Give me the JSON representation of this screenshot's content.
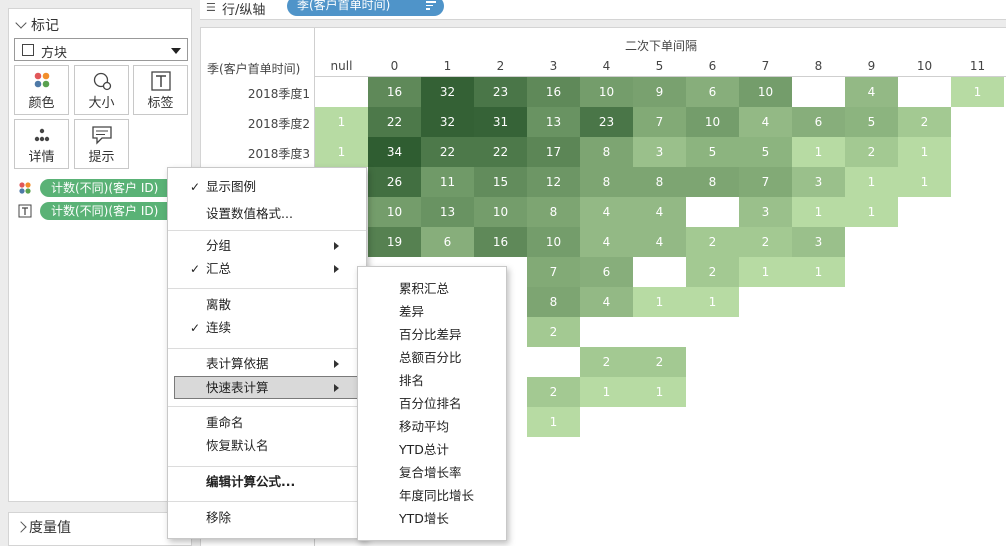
{
  "marks": {
    "title": "标记",
    "mark_type": "方块",
    "buttons": [
      {
        "label": "颜色",
        "icon": "color-dots-icon"
      },
      {
        "label": "大小",
        "icon": "size-icon"
      },
      {
        "label": "标签",
        "icon": "label-T-icon"
      },
      {
        "label": "详情",
        "icon": "detail-dots-icon"
      },
      {
        "label": "提示",
        "icon": "tooltip-icon"
      }
    ],
    "pills": [
      {
        "label": "计数(不同)(客户 ID)",
        "icon": "color-dots-icon"
      },
      {
        "label": "计数(不同)(客户 ID)",
        "icon": "label-T-icon"
      }
    ]
  },
  "measure_values": {
    "label": "度量值"
  },
  "rows_shelf": {
    "label": "行/纵轴",
    "pill": "季(客户首单时间)",
    "accent": "#4f94c9"
  },
  "view": {
    "column_header_title": "二次下单间隔",
    "row_header_title": "季(客户首单时间)",
    "columns": [
      "null",
      "0",
      "1",
      "2",
      "3",
      "4",
      "5",
      "6",
      "7",
      "8",
      "9",
      "10",
      "11"
    ],
    "rows": [
      {
        "label": "2018季度1",
        "values": [
          null,
          16,
          32,
          23,
          16,
          10,
          9,
          6,
          10,
          null,
          4,
          null,
          1
        ]
      },
      {
        "label": "2018季度2",
        "values": [
          1,
          22,
          32,
          31,
          13,
          23,
          7,
          10,
          4,
          6,
          5,
          2,
          null
        ]
      },
      {
        "label": "2018季度3",
        "values": [
          1,
          34,
          22,
          22,
          17,
          8,
          3,
          5,
          5,
          1,
          2,
          1,
          null
        ]
      },
      {
        "label": "",
        "values": [
          null,
          26,
          11,
          15,
          12,
          8,
          8,
          8,
          7,
          3,
          1,
          1,
          null
        ]
      },
      {
        "label": "",
        "values": [
          null,
          10,
          13,
          10,
          8,
          4,
          4,
          null,
          3,
          1,
          1,
          null,
          null
        ]
      },
      {
        "label": "",
        "values": [
          null,
          19,
          6,
          16,
          10,
          4,
          4,
          2,
          2,
          3,
          null,
          null,
          null
        ]
      },
      {
        "label": "",
        "values": [
          null,
          null,
          null,
          null,
          7,
          6,
          null,
          2,
          1,
          1,
          null,
          null,
          null
        ]
      },
      {
        "label": "",
        "values": [
          null,
          null,
          null,
          null,
          8,
          4,
          1,
          1,
          null,
          null,
          null,
          null,
          null
        ]
      },
      {
        "label": "",
        "values": [
          null,
          null,
          null,
          null,
          2,
          null,
          null,
          null,
          null,
          null,
          null,
          null,
          null
        ]
      },
      {
        "label": "",
        "values": [
          null,
          null,
          null,
          null,
          null,
          2,
          2,
          null,
          null,
          null,
          null,
          null,
          null
        ]
      },
      {
        "label": "",
        "values": [
          null,
          null,
          null,
          null,
          2,
          1,
          1,
          null,
          null,
          null,
          null,
          null,
          null
        ]
      },
      {
        "label": "",
        "values": [
          null,
          null,
          null,
          null,
          1,
          null,
          null,
          null,
          null,
          null,
          null,
          null,
          null
        ]
      }
    ],
    "color_low": "#b7dba3",
    "color_high": "#2f5d31"
  },
  "context_menu": {
    "items": [
      {
        "label": "显示图例",
        "checked": true
      },
      {
        "label": "设置数值格式..."
      },
      {
        "label": "分组",
        "submenu": true
      },
      {
        "label": "汇总",
        "checked": true,
        "submenu": true
      },
      {
        "label": "离散"
      },
      {
        "label": "连续",
        "checked": true
      },
      {
        "label": "表计算依据",
        "submenu": true
      },
      {
        "label": "快速表计算",
        "submenu": true,
        "highlighted": true
      },
      {
        "label": "重命名"
      },
      {
        "label": "恢复默认名"
      },
      {
        "label": "编辑计算公式...",
        "bold": true
      },
      {
        "label": "移除"
      }
    ],
    "check_glyph": "✓"
  },
  "quick_calc_menu": {
    "items": [
      "累积汇总",
      "差异",
      "百分比差异",
      "总额百分比",
      "排名",
      "百分位排名",
      "移动平均",
      "YTD总计",
      "复合增长率",
      "年度同比增长",
      "YTD增长"
    ]
  }
}
